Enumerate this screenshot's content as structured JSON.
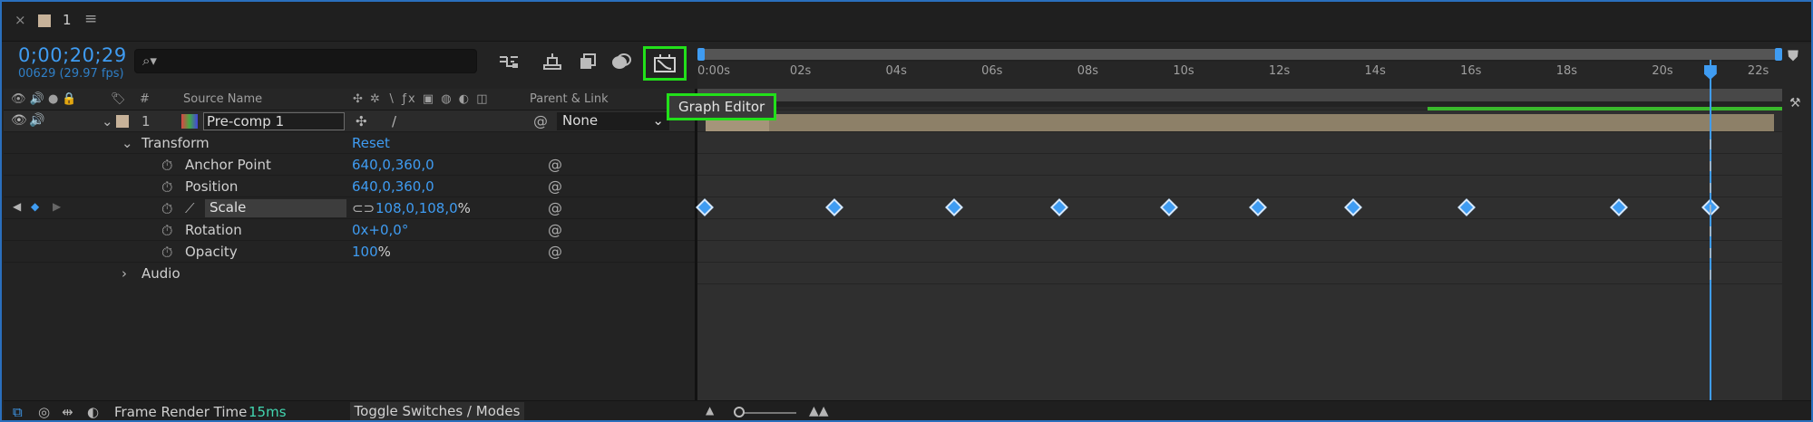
{
  "tab": {
    "close": "×",
    "name": "1",
    "menu": "≡",
    "swatch_color": "#c7b299"
  },
  "toolbar": {
    "timecode": "0;00;20;29",
    "fps": "00629 (29.97 fps)",
    "search_placeholder": "",
    "tools": [
      "composition-mini-flowchart-icon",
      "draft-3d-icon",
      "hide-shy-layers-icon",
      "frame-blending-icon",
      "motion-blur-icon"
    ],
    "graph_editor_icon": "graph-editor-icon"
  },
  "tooltip": {
    "text": "Graph Editor"
  },
  "columns": {
    "source_name": "Source Name",
    "hash": "#",
    "parent_link": "Parent & Link"
  },
  "layer": {
    "number": "1",
    "name": "Pre-comp 1",
    "parent": "None",
    "color": "#c7b299"
  },
  "transform": {
    "label": "Transform",
    "reset": "Reset",
    "properties": [
      {
        "name": "Anchor Point",
        "value": "640,0,360,0"
      },
      {
        "name": "Position",
        "value": "640,0,360,0"
      },
      {
        "name": "Scale",
        "value": "108,0,108,0",
        "unit": "%"
      },
      {
        "name": "Rotation",
        "value_a": "0x",
        "value_b": "+0,0°"
      },
      {
        "name": "Opacity",
        "value": "100",
        "unit": "%"
      }
    ]
  },
  "audio": {
    "label": "Audio"
  },
  "ruler": {
    "labels": [
      "0:00s",
      "02s",
      "04s",
      "06s",
      "08s",
      "10s",
      "12s",
      "14s",
      "16s",
      "18s",
      "20s",
      "22s"
    ],
    "duration_seconds": 22.5
  },
  "keyframes_seconds": [
    0,
    2.7,
    5.2,
    7.4,
    9.7,
    11.55,
    13.55,
    15.9,
    19.1,
    21.0
  ],
  "playhead_seconds": 21.0,
  "bottom": {
    "frame_render_label": "Frame Render Time",
    "frame_render_value": "15ms",
    "toggle_label": "Toggle Switches / Modes"
  }
}
